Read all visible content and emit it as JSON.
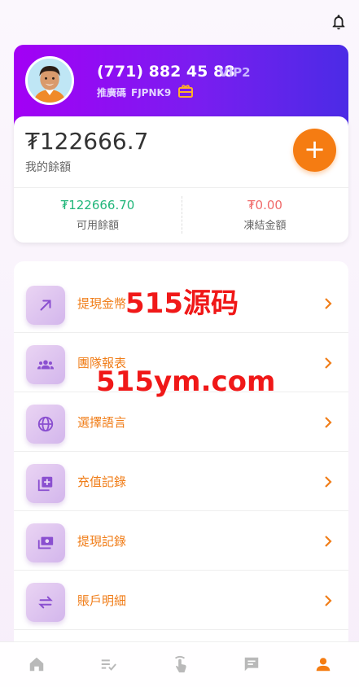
{
  "header": {
    "bell_icon": "bell-icon"
  },
  "profile": {
    "phone": "(771) 882 45 88",
    "vip": "VIP2",
    "referral_label": "推廣碼",
    "referral_code": "FJPNK9"
  },
  "balance": {
    "amount": "₮122666.7",
    "label": "我的餘額",
    "available_amount": "₮122666.70",
    "available_label": "可用餘額",
    "frozen_amount": "₮0.00",
    "frozen_label": "凍結金額"
  },
  "menu": {
    "items": [
      {
        "label": "提現金幣",
        "icon": "arrow-up-right-icon"
      },
      {
        "label": "團隊報表",
        "icon": "group-icon"
      },
      {
        "label": "選擇語言",
        "icon": "globe-icon"
      },
      {
        "label": "充值記錄",
        "icon": "add-box-icon"
      },
      {
        "label": "提現記錄",
        "icon": "cash-icon"
      },
      {
        "label": "賬戶明細",
        "icon": "swap-icon"
      }
    ]
  },
  "watermark": {
    "line1": "515源码",
    "line2": "515ym.com"
  },
  "nav": {
    "items": [
      {
        "icon": "home-icon"
      },
      {
        "icon": "list-check-icon"
      },
      {
        "icon": "tap-icon"
      },
      {
        "icon": "message-icon"
      },
      {
        "icon": "person-icon"
      }
    ]
  },
  "colors": {
    "accent": "#f57c12",
    "gradient_start": "#a300f5",
    "gradient_end": "#4b2be6",
    "available": "#21b67a",
    "frozen": "#f06a6a"
  }
}
